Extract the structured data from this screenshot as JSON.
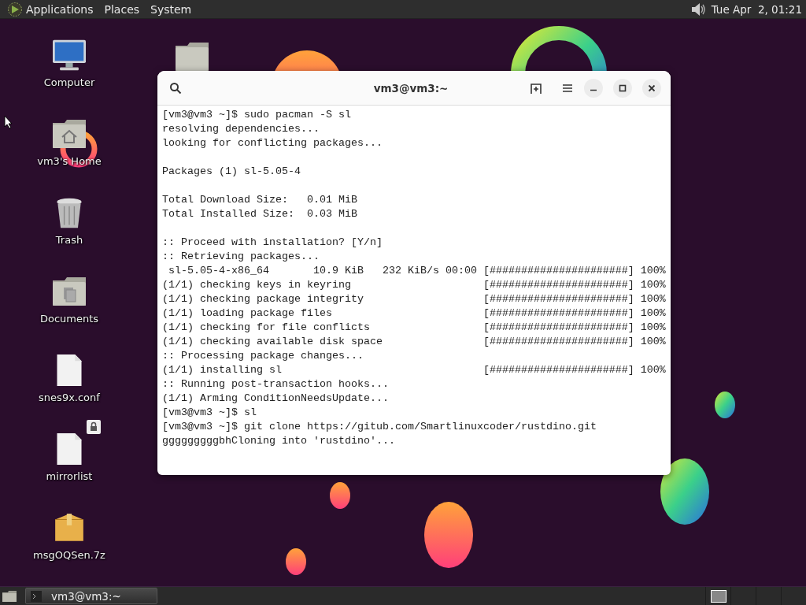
{
  "top_panel": {
    "menus": [
      "Applications",
      "Places",
      "System"
    ],
    "clock": "Tue Apr  2, 01:21"
  },
  "desktop_icons": [
    {
      "kind": "computer",
      "label": "Computer"
    },
    {
      "kind": "home",
      "label": "vm3's Home"
    },
    {
      "kind": "trash",
      "label": "Trash"
    },
    {
      "kind": "documents",
      "label": "Documents"
    },
    {
      "kind": "file",
      "label": "snes9x.conf"
    },
    {
      "kind": "locked-file",
      "label": "mirrorlist"
    },
    {
      "kind": "archive",
      "label": "msgOQSen.7z"
    }
  ],
  "terminal": {
    "title": "vm3@vm3:~",
    "blocks": [
      [
        "[vm3@vm3 ~]$ sudo pacman -S sl",
        "resolving dependencies...",
        "looking for conflicting packages..."
      ],
      [
        "Packages (1) sl-5.05-4"
      ],
      [
        "Total Download Size:   0.01 MiB",
        "Total Installed Size:  0.03 MiB"
      ],
      [
        ":: Proceed with installation? [Y/n]",
        ":: Retrieving packages...",
        " sl-5.05-4-x86_64       10.9 KiB   232 KiB/s 00:00 [######################] 100%",
        "(1/1) checking keys in keyring                     [######################] 100%",
        "(1/1) checking package integrity                   [######################] 100%",
        "(1/1) loading package files                        [######################] 100%",
        "(1/1) checking for file conflicts                  [######################] 100%",
        "(1/1) checking available disk space                [######################] 100%",
        ":: Processing package changes...",
        "(1/1) installing sl                                [######################] 100%",
        ":: Running post-transaction hooks...",
        "(1/1) Arming ConditionNeedsUpdate...",
        "[vm3@vm3 ~]$ sl",
        "[vm3@vm3 ~]$ git clone https://gitub.com/Smartlinuxcoder/rustdino.git",
        "gggggggggbhCloning into 'rustdino'..."
      ]
    ]
  },
  "taskbar": {
    "tasks": [
      {
        "label": "vm3@vm3:~"
      }
    ],
    "workspaces": [
      {
        "selected": true
      },
      {
        "selected": false
      },
      {
        "selected": false
      },
      {
        "selected": false
      }
    ]
  }
}
